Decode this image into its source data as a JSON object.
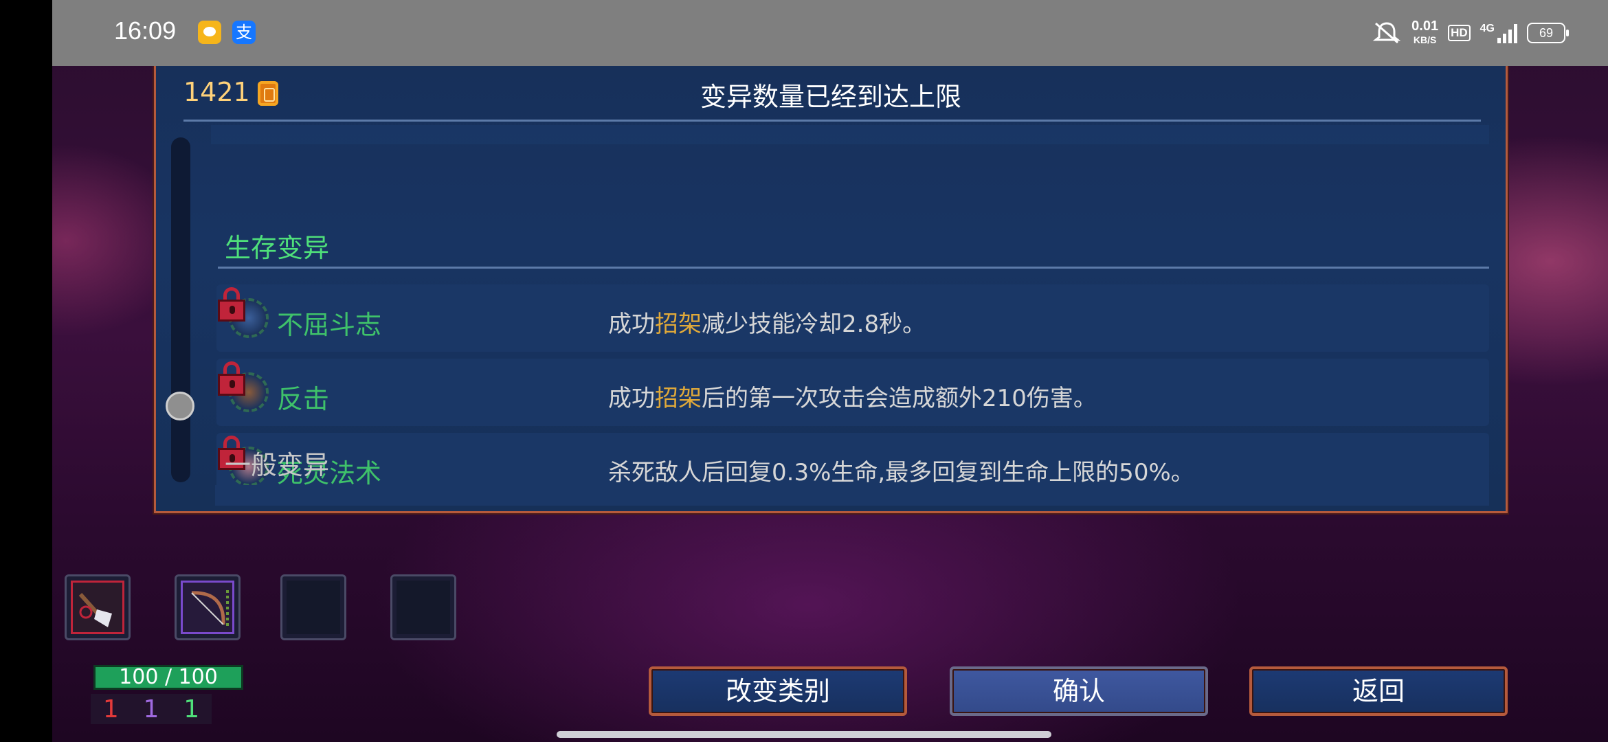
{
  "status_bar": {
    "time": "16:09",
    "alipay_glyph": "支",
    "net_speed": "0.01",
    "net_unit": "KB/S",
    "hd": "HD",
    "network": "4G",
    "battery": "69"
  },
  "panel": {
    "gold": "1421",
    "title": "变异数量已经到达上限",
    "section_title": "生存变异",
    "mutations": [
      {
        "name": "不屈斗志",
        "desc_pre": "成功",
        "desc_hl": "招架",
        "desc_post": "减少技能冷却2.8秒。",
        "locked": true,
        "icon": "blue-orb-icon"
      },
      {
        "name": "反击",
        "desc_pre": "成功",
        "desc_hl": "招架",
        "desc_post": "后的第一次攻击会造成额外210伤害。",
        "locked": true,
        "icon": "counter-sword-icon"
      },
      {
        "name": "死灵法术",
        "desc_pre": "",
        "desc_hl": "",
        "desc_post": "杀死敌人后回复0.3%生命,最多回复到生命上限的50%。",
        "locked": true,
        "icon": "skull-icon"
      }
    ],
    "next_section": "一般变异"
  },
  "player": {
    "hp": "100 / 100",
    "stat_red": "1",
    "stat_purple": "1",
    "stat_green": "1"
  },
  "buttons": {
    "change_category": "改变类别",
    "confirm": "确认",
    "back": "返回"
  },
  "colors": {
    "accent_green": "#3fc26a",
    "highlight_gold": "#e0a93a",
    "panel_border": "#b55a3c"
  }
}
